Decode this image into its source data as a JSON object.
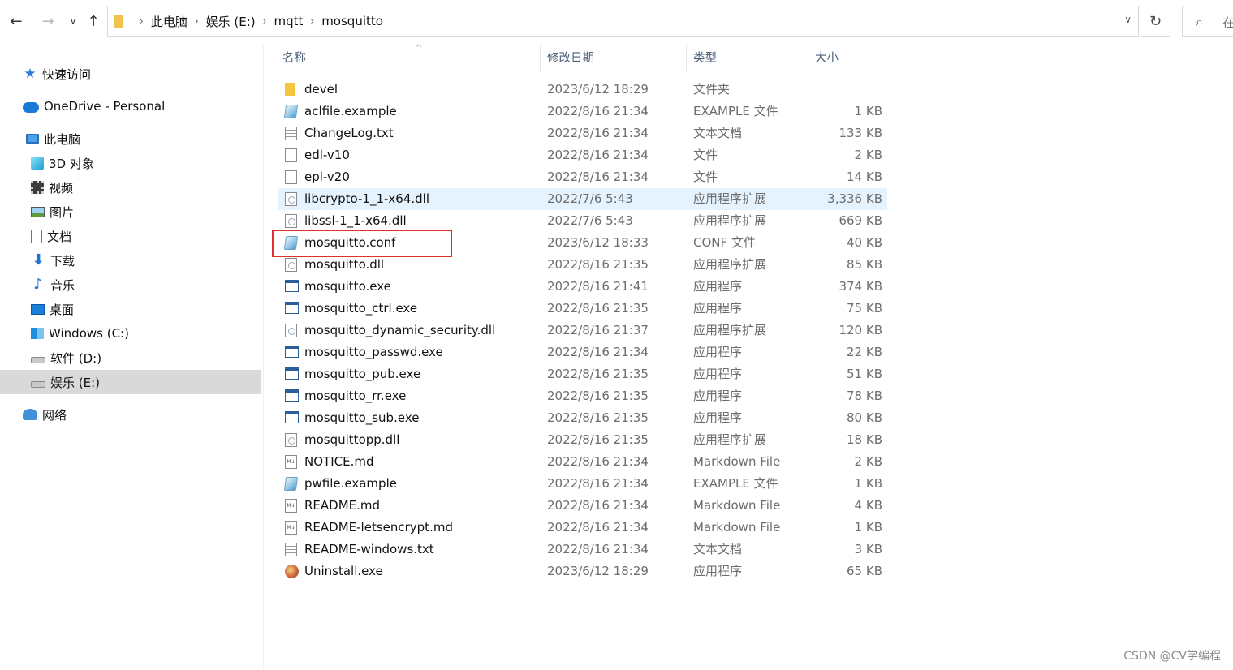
{
  "nav": {
    "back_glyph": "←",
    "forward_glyph": "→",
    "recent_glyph": "∨",
    "up_glyph": "↑",
    "refresh_glyph": "↻",
    "search_glyph": "⌕"
  },
  "address": {
    "crumbs": [
      "此电脑",
      "娱乐 (E:)",
      "mqtt",
      "mosquitto"
    ],
    "separator": "›",
    "dropdown_glyph": "∨",
    "search_placeholder": "在"
  },
  "sidebar": {
    "quick_access": "快速访问",
    "onedrive": "OneDrive - Personal",
    "this_pc": "此电脑",
    "items": [
      {
        "label": "3D 对象",
        "icon": "3d-objects-icon"
      },
      {
        "label": "视频",
        "icon": "video-icon"
      },
      {
        "label": "图片",
        "icon": "pictures-icon"
      },
      {
        "label": "文档",
        "icon": "documents-icon"
      },
      {
        "label": "下载",
        "icon": "downloads-icon"
      },
      {
        "label": "音乐",
        "icon": "music-icon"
      },
      {
        "label": "桌面",
        "icon": "desktop-icon"
      },
      {
        "label": "Windows (C:)",
        "icon": "windows-drive-icon"
      },
      {
        "label": "软件 (D:)",
        "icon": "drive-icon"
      },
      {
        "label": "娱乐 (E:)",
        "icon": "drive-icon",
        "selected": true
      }
    ],
    "network": "网络"
  },
  "columns": {
    "name": "名称",
    "date": "修改日期",
    "type": "类型",
    "size": "大小",
    "sort_glyph": "^"
  },
  "files": [
    {
      "name": "devel",
      "date": "2023/6/12 18:29",
      "type": "文件夹",
      "size": "",
      "icon": "folder"
    },
    {
      "name": "aclfile.example",
      "date": "2022/8/16 21:34",
      "type": "EXAMPLE 文件",
      "size": "1 KB",
      "icon": "config"
    },
    {
      "name": "ChangeLog.txt",
      "date": "2022/8/16 21:34",
      "type": "文本文档",
      "size": "133 KB",
      "icon": "text"
    },
    {
      "name": "edl-v10",
      "date": "2022/8/16 21:34",
      "type": "文件",
      "size": "2 KB",
      "icon": "blank"
    },
    {
      "name": "epl-v20",
      "date": "2022/8/16 21:34",
      "type": "文件",
      "size": "14 KB",
      "icon": "blank"
    },
    {
      "name": "libcrypto-1_1-x64.dll",
      "date": "2022/7/6 5:43",
      "type": "应用程序扩展",
      "size": "3,336 KB",
      "icon": "dll",
      "hover": true
    },
    {
      "name": "libssl-1_1-x64.dll",
      "date": "2022/7/6 5:43",
      "type": "应用程序扩展",
      "size": "669 KB",
      "icon": "dll"
    },
    {
      "name": "mosquitto.conf",
      "date": "2023/6/12 18:33",
      "type": "CONF 文件",
      "size": "40 KB",
      "icon": "config"
    },
    {
      "name": "mosquitto.dll",
      "date": "2022/8/16 21:35",
      "type": "应用程序扩展",
      "size": "85 KB",
      "icon": "dll"
    },
    {
      "name": "mosquitto.exe",
      "date": "2022/8/16 21:41",
      "type": "应用程序",
      "size": "374 KB",
      "icon": "exe"
    },
    {
      "name": "mosquitto_ctrl.exe",
      "date": "2022/8/16 21:35",
      "type": "应用程序",
      "size": "75 KB",
      "icon": "exe"
    },
    {
      "name": "mosquitto_dynamic_security.dll",
      "date": "2022/8/16 21:37",
      "type": "应用程序扩展",
      "size": "120 KB",
      "icon": "dll"
    },
    {
      "name": "mosquitto_passwd.exe",
      "date": "2022/8/16 21:34",
      "type": "应用程序",
      "size": "22 KB",
      "icon": "exe"
    },
    {
      "name": "mosquitto_pub.exe",
      "date": "2022/8/16 21:35",
      "type": "应用程序",
      "size": "51 KB",
      "icon": "exe"
    },
    {
      "name": "mosquitto_rr.exe",
      "date": "2022/8/16 21:35",
      "type": "应用程序",
      "size": "78 KB",
      "icon": "exe"
    },
    {
      "name": "mosquitto_sub.exe",
      "date": "2022/8/16 21:35",
      "type": "应用程序",
      "size": "80 KB",
      "icon": "exe"
    },
    {
      "name": "mosquittopp.dll",
      "date": "2022/8/16 21:35",
      "type": "应用程序扩展",
      "size": "18 KB",
      "icon": "dll"
    },
    {
      "name": "NOTICE.md",
      "date": "2022/8/16 21:34",
      "type": "Markdown File",
      "size": "2 KB",
      "icon": "markdown"
    },
    {
      "name": "pwfile.example",
      "date": "2022/8/16 21:34",
      "type": "EXAMPLE 文件",
      "size": "1 KB",
      "icon": "config"
    },
    {
      "name": "README.md",
      "date": "2022/8/16 21:34",
      "type": "Markdown File",
      "size": "4 KB",
      "icon": "markdown"
    },
    {
      "name": "README-letsencrypt.md",
      "date": "2022/8/16 21:34",
      "type": "Markdown File",
      "size": "1 KB",
      "icon": "markdown"
    },
    {
      "name": "README-windows.txt",
      "date": "2022/8/16 21:34",
      "type": "文本文档",
      "size": "3 KB",
      "icon": "text"
    },
    {
      "name": "Uninstall.exe",
      "date": "2023/6/12 18:29",
      "type": "应用程序",
      "size": "65 KB",
      "icon": "uninstaller"
    }
  ],
  "markdown_icon_text": "M↓",
  "watermark": "CSDN @CV学编程"
}
